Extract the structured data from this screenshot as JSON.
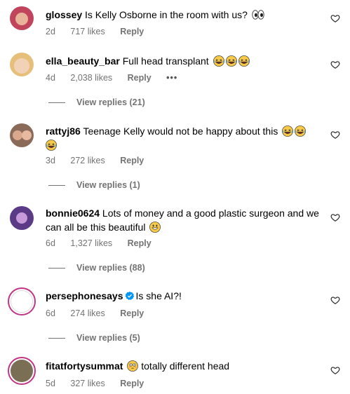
{
  "comments": [
    {
      "username": "glossey",
      "text": "Is Kelly Osborne in the room with us?",
      "emoji": [
        "eyes"
      ],
      "time": "2d",
      "likes": "717 likes",
      "reply": "Reply",
      "avatar_color": "#c0445c"
    },
    {
      "username": "ella_beauty_bar",
      "text": "Full head transplant",
      "emoji": [
        "laughing",
        "laughing",
        "laughing"
      ],
      "time": "4d",
      "likes": "2,038 likes",
      "reply": "Reply",
      "more": "•••",
      "view_replies": "View replies (21)",
      "avatar_color": "#e6c07a"
    },
    {
      "username": "rattyj86",
      "text": "Teenage Kelly would not be happy about this",
      "emoji": [
        "laughing",
        "laughing",
        "laughing"
      ],
      "time": "3d",
      "likes": "272 likes",
      "reply": "Reply",
      "view_replies": "View replies (1)",
      "avatar_color": "#8a6b5a"
    },
    {
      "username": "bonnie0624",
      "text": "Lots of money and a good plastic surgeon and we can all be this beautiful",
      "emoji": [
        "grin"
      ],
      "time": "6d",
      "likes": "1,327 likes",
      "reply": "Reply",
      "view_replies": "View replies (88)",
      "avatar_color": "#5b3a86"
    },
    {
      "username": "persephonesays",
      "text": "Is she AI?!",
      "verified": true,
      "time": "6d",
      "likes": "274 likes",
      "reply": "Reply",
      "view_replies": "View replies (5)",
      "avatar_color": "#ffffff"
    },
    {
      "username": "fitatfortysummat",
      "text": "totally different head",
      "emoji_before": [
        "flushed"
      ],
      "time": "5d",
      "likes": "327 likes",
      "reply": "Reply",
      "avatar_color": "#7a6e55"
    }
  ],
  "icons": {
    "heart": "heart-outline-icon",
    "verified": "verified-badge-icon"
  },
  "colors": {
    "meta_text": "#737373",
    "verified_blue": "#0095f6",
    "emoji_yellow": "#f7c948"
  }
}
